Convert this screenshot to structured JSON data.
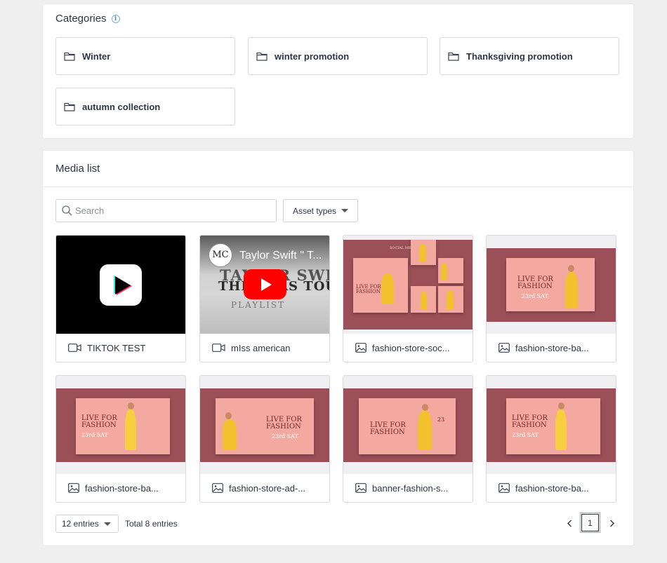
{
  "categories": {
    "title": "Categories",
    "info_icon": "info-icon",
    "items": [
      {
        "label": "Winter",
        "icon": "folder-icon"
      },
      {
        "label": "winter promotion",
        "icon": "folder-icon"
      },
      {
        "label": "Thanksgiving promotion",
        "icon": "folder-icon"
      },
      {
        "label": "autumn collection",
        "icon": "folder-icon"
      }
    ]
  },
  "media": {
    "title": "Media list",
    "search": {
      "placeholder": "Search",
      "value": ""
    },
    "asset_types_label": "Asset types",
    "items": [
      {
        "name": "TIKTOK TEST",
        "type": "video",
        "icon": "video-icon"
      },
      {
        "name": "mIss american",
        "type": "video",
        "icon": "video-icon",
        "preview_title": "Taylor Swift \" T...",
        "preview_avatar": "MC",
        "preview_text": "TAYLOR SWIFT",
        "preview_text_2": "THE ERAS TOUR",
        "preview_sub": "PLAYLIST"
      },
      {
        "name": "fashion-store-soc...",
        "type": "image",
        "icon": "image-icon",
        "preview_header": "SOCIAL MEDIA POST"
      },
      {
        "name": "fashion-store-ba...",
        "type": "image",
        "icon": "image-icon"
      },
      {
        "name": "fashion-store-ba...",
        "type": "image",
        "icon": "image-icon"
      },
      {
        "name": "fashion-store-ad-...",
        "type": "image",
        "icon": "image-icon"
      },
      {
        "name": "banner-fashion-s...",
        "type": "image",
        "icon": "image-icon"
      },
      {
        "name": "fashion-store-ba...",
        "type": "image",
        "icon": "image-icon"
      }
    ],
    "banner_text": {
      "line1": "LIVE FOR",
      "line2": "FASHION",
      "date": "23rd SAT",
      "date_short": "23"
    },
    "entries_label": "12 entries",
    "total_label": "Total 8 entries",
    "pagination": {
      "current": "1",
      "prev_icon": "chevron-left-icon",
      "next_icon": "chevron-right-icon"
    }
  },
  "colors": {
    "banner": "#9b4f57",
    "banner_card": "#f4a9a0",
    "accent_red": "#ff0000"
  }
}
